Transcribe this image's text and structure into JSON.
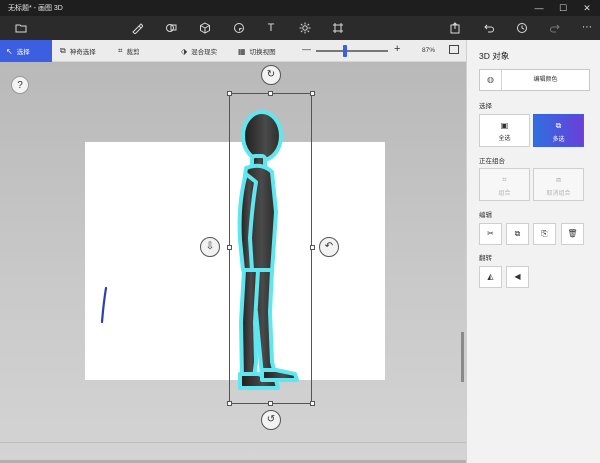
{
  "window": {
    "title": "无标题* - 画图 3D",
    "minimize": "—",
    "maximize": "☐",
    "close": "✕"
  },
  "subbar": {
    "select": "选择",
    "magic_select": "神奇选择",
    "crop": "裁剪",
    "mixed_reality": "混合现实",
    "toggle_view": "切换视图",
    "zoom_minus": "—",
    "zoom_plus": "+",
    "zoom_value": "87%"
  },
  "canvas": {
    "help": "?"
  },
  "panel": {
    "title": "3D 对象",
    "edit_color": "编辑颜色",
    "section_select": "选择",
    "select_all": "全选",
    "multi_select": "多选",
    "section_group": "正在组合",
    "group": "组合",
    "ungroup": "取消组合",
    "section_edit": "编辑",
    "section_flip": "翻转"
  },
  "colors": {
    "accent": "#3c5ee0",
    "selection_glow": "#5fe6ef",
    "stroke": "#2a3fb0"
  }
}
